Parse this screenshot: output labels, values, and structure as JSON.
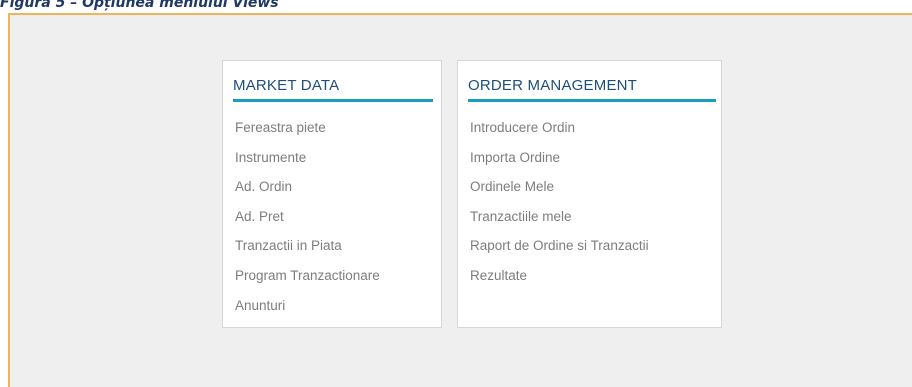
{
  "caption": "Figura 5 – Opțiunea meniului Views",
  "colors": {
    "frame_border": "#f2b35c",
    "frame_background": "#efefef",
    "title_text": "#1d4f7c",
    "underline": "#1a9cc6",
    "item_text": "#7d7d7d"
  },
  "menus": {
    "market_data": {
      "title": "MARKET DATA",
      "items": [
        "Fereastra piete",
        "Instrumente",
        "Ad. Ordin",
        "Ad. Pret",
        "Tranzactii in Piata",
        "Program Tranzactionare",
        "Anunturi"
      ]
    },
    "order_management": {
      "title": "ORDER MANAGEMENT",
      "items": [
        "Introducere Ordin",
        "Importa Ordine",
        "Ordinele Mele",
        "Tranzactiile mele",
        "Raport de Ordine si Tranzactii",
        "Rezultate"
      ]
    }
  },
  "scroll_indicator_icon": "vertical-ellipsis-icon"
}
